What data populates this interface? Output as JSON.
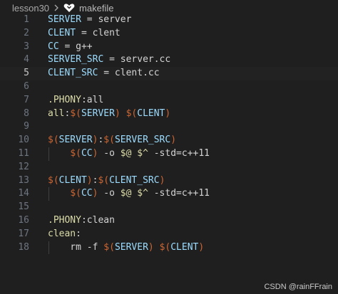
{
  "breadcrumb": {
    "folder": "lesson30",
    "file": "makefile",
    "separator_icon": "chevron-right-icon",
    "file_icon": "makefile-icon"
  },
  "editor": {
    "current_line": 5,
    "lines": [
      {
        "n": "1",
        "tokens": [
          {
            "t": "SERVER",
            "c": "var"
          },
          {
            "t": " = server",
            "c": "plain"
          }
        ]
      },
      {
        "n": "2",
        "tokens": [
          {
            "t": "CLENT",
            "c": "var"
          },
          {
            "t": " = clent",
            "c": "plain"
          }
        ]
      },
      {
        "n": "3",
        "tokens": [
          {
            "t": "CC",
            "c": "var"
          },
          {
            "t": " = g++",
            "c": "plain"
          }
        ]
      },
      {
        "n": "4",
        "tokens": [
          {
            "t": "SERVER_SRC",
            "c": "var"
          },
          {
            "t": " = server.cc",
            "c": "plain"
          }
        ]
      },
      {
        "n": "5",
        "tokens": [
          {
            "t": "CLENT_SRC",
            "c": "var"
          },
          {
            "t": " = clent.cc",
            "c": "plain"
          }
        ]
      },
      {
        "n": "6",
        "tokens": []
      },
      {
        "n": "7",
        "tokens": [
          {
            "t": ".PHONY",
            "c": "kw"
          },
          {
            "t": ":all",
            "c": "plain"
          }
        ]
      },
      {
        "n": "8",
        "tokens": [
          {
            "t": "all",
            "c": "target"
          },
          {
            "t": ":",
            "c": "plain"
          },
          {
            "t": "$(",
            "c": "dol"
          },
          {
            "t": "SERVER",
            "c": "macro"
          },
          {
            "t": ")",
            "c": "dol"
          },
          {
            "t": " ",
            "c": "plain"
          },
          {
            "t": "$(",
            "c": "dol"
          },
          {
            "t": "CLENT",
            "c": "macro"
          },
          {
            "t": ")",
            "c": "dol"
          }
        ]
      },
      {
        "n": "9",
        "tokens": []
      },
      {
        "n": "10",
        "tokens": [
          {
            "t": "$(",
            "c": "dol"
          },
          {
            "t": "SERVER",
            "c": "macro"
          },
          {
            "t": ")",
            "c": "dol"
          },
          {
            "t": ":",
            "c": "plain"
          },
          {
            "t": "$(",
            "c": "dol"
          },
          {
            "t": "SERVER_SRC",
            "c": "macro"
          },
          {
            "t": ")",
            "c": "dol"
          }
        ]
      },
      {
        "n": "11",
        "indent": true,
        "tokens": [
          {
            "t": "    ",
            "c": "plain"
          },
          {
            "t": "$(",
            "c": "dol"
          },
          {
            "t": "CC",
            "c": "macro"
          },
          {
            "t": ")",
            "c": "dol"
          },
          {
            "t": " -o ",
            "c": "plain"
          },
          {
            "t": "$@",
            "c": "auto"
          },
          {
            "t": " ",
            "c": "plain"
          },
          {
            "t": "$^",
            "c": "auto"
          },
          {
            "t": " -std=c++11",
            "c": "plain"
          }
        ]
      },
      {
        "n": "12",
        "tokens": []
      },
      {
        "n": "13",
        "tokens": [
          {
            "t": "$(",
            "c": "dol"
          },
          {
            "t": "CLENT",
            "c": "macro"
          },
          {
            "t": ")",
            "c": "dol"
          },
          {
            "t": ":",
            "c": "plain"
          },
          {
            "t": "$(",
            "c": "dol"
          },
          {
            "t": "CLENT_SRC",
            "c": "macro"
          },
          {
            "t": ")",
            "c": "dol"
          }
        ]
      },
      {
        "n": "14",
        "indent": true,
        "tokens": [
          {
            "t": "    ",
            "c": "plain"
          },
          {
            "t": "$(",
            "c": "dol"
          },
          {
            "t": "CC",
            "c": "macro"
          },
          {
            "t": ")",
            "c": "dol"
          },
          {
            "t": " -o ",
            "c": "plain"
          },
          {
            "t": "$@",
            "c": "auto"
          },
          {
            "t": " ",
            "c": "plain"
          },
          {
            "t": "$^",
            "c": "auto"
          },
          {
            "t": " -std=c++11",
            "c": "plain"
          }
        ]
      },
      {
        "n": "15",
        "tokens": []
      },
      {
        "n": "16",
        "tokens": [
          {
            "t": ".PHONY",
            "c": "kw"
          },
          {
            "t": ":clean",
            "c": "plain"
          }
        ]
      },
      {
        "n": "17",
        "tokens": [
          {
            "t": "clean",
            "c": "target"
          },
          {
            "t": ":",
            "c": "plain"
          }
        ]
      },
      {
        "n": "18",
        "indent": true,
        "tokens": [
          {
            "t": "    rm -f ",
            "c": "plain"
          },
          {
            "t": "$(",
            "c": "dol"
          },
          {
            "t": "SERVER",
            "c": "macro"
          },
          {
            "t": ")",
            "c": "dol"
          },
          {
            "t": " ",
            "c": "plain"
          },
          {
            "t": "$(",
            "c": "dol"
          },
          {
            "t": "CLENT",
            "c": "macro"
          },
          {
            "t": ")",
            "c": "dol"
          }
        ]
      }
    ]
  },
  "watermark": "CSDN @rainFFrain",
  "colors": {
    "background": "#1f1f1f",
    "variable": "#9cdcfe",
    "dollar": "#cc6633",
    "keyword": "#dcdcaa",
    "text": "#d4d4d4",
    "line_number": "#6e7681"
  }
}
